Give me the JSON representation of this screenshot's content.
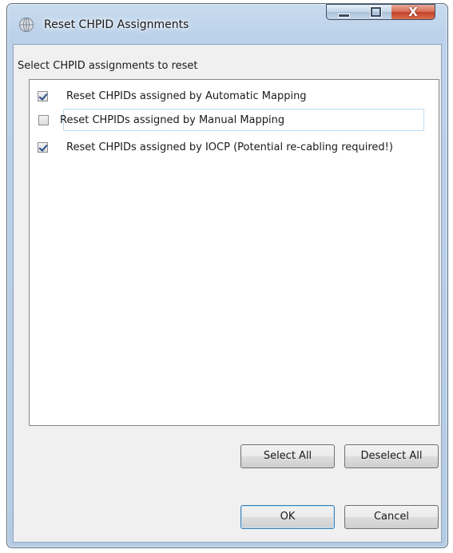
{
  "window": {
    "title": "Reset CHPID Assignments",
    "icon": "globe-icon",
    "minimize_glyph": "",
    "maximize_glyph": "",
    "close_glyph": "X"
  },
  "group_label": "Select CHPID assignments to reset",
  "items": [
    {
      "label": "Reset CHPIDs assigned by Automatic Mapping",
      "checked": true
    },
    {
      "label": "Reset CHPIDs assigned by Manual Mapping",
      "checked": false
    },
    {
      "label": "Reset CHPIDs assigned by IOCP (Potential re-cabling required!)",
      "checked": true
    }
  ],
  "buttons": {
    "select_all": "Select All",
    "deselect_all": "Deselect All",
    "ok": "OK",
    "cancel": "Cancel"
  },
  "colors": {
    "titlebar": "#bcd2ea",
    "close_button": "#c4402a",
    "check_color": "#2a4f8a"
  }
}
